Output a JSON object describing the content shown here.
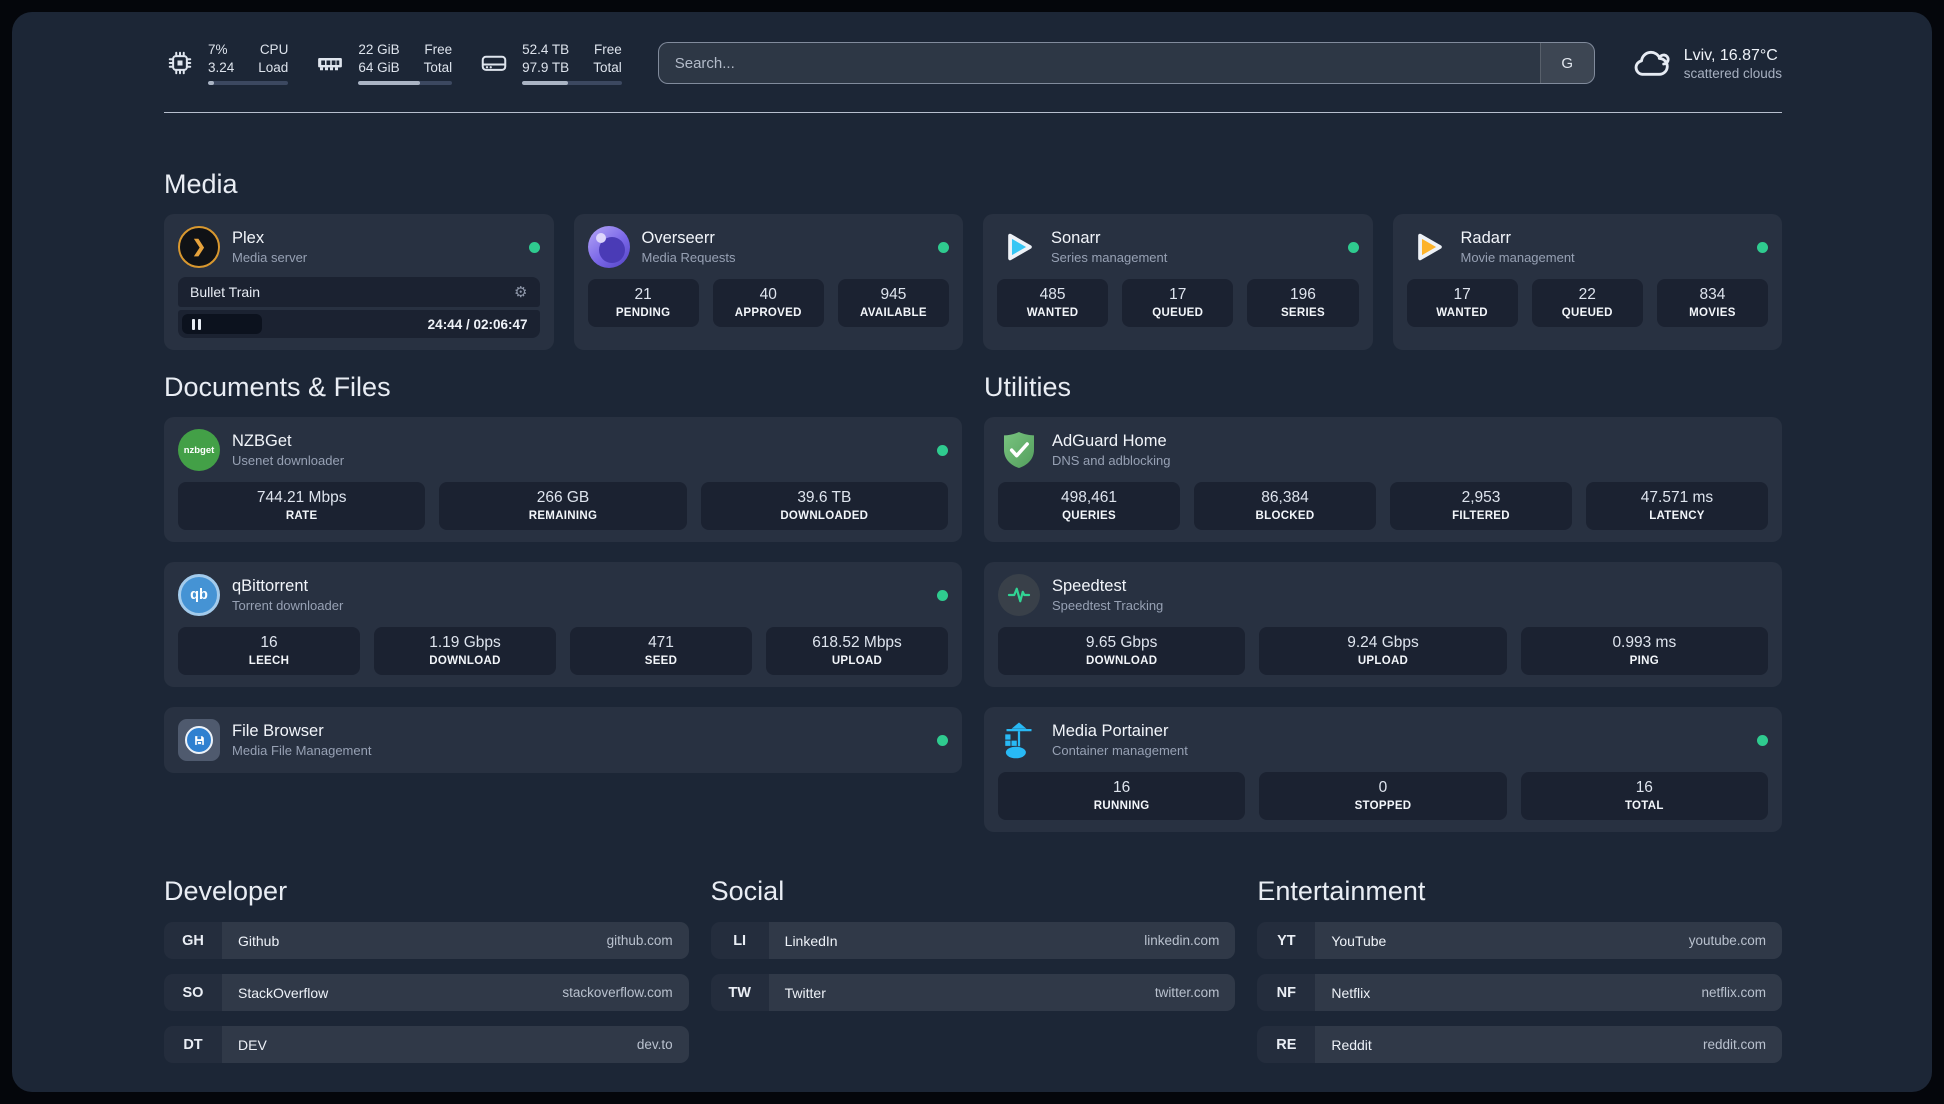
{
  "colors": {
    "background": "#1c2636",
    "card": "#263040",
    "status_online": "#2fcb8f",
    "plex_amber": "#e7a33c",
    "sonarr_cyan": "#36c6f4",
    "radarr_yellow": "#fdb32a",
    "portainer_blue": "#28b9f5"
  },
  "header": {
    "resources": [
      {
        "icon": "cpu-icon",
        "value_top": "7%",
        "value_bottom": "3.24",
        "label_top": "CPU",
        "label_bottom": "Load",
        "progress": 7
      },
      {
        "icon": "memory-icon",
        "value_top": "22 GiB",
        "value_bottom": "64 GiB",
        "label_top": "Free",
        "label_bottom": "Total",
        "progress": 66
      },
      {
        "icon": "disk-icon",
        "value_top": "52.4 TB",
        "value_bottom": "97.9 TB",
        "label_top": "Free",
        "label_bottom": "Total",
        "progress": 46
      }
    ],
    "search": {
      "placeholder": "Search...",
      "provider": "G"
    },
    "weather": {
      "icon": "cloud-icon",
      "location": "Lviv, 16.87°C",
      "condition": "scattered clouds"
    }
  },
  "sections": {
    "media": {
      "title": "Media",
      "plex": {
        "name": "Plex",
        "description": "Media server",
        "icon": "plex-icon",
        "status": "online",
        "now_playing": {
          "title": "Bullet Train",
          "time": "24:44 / 02:06:47",
          "progress_percent": 22,
          "state": "paused"
        }
      },
      "overseerr": {
        "name": "Overseerr",
        "description": "Media Requests",
        "icon": "overseerr-icon",
        "status": "online",
        "stats": [
          {
            "value": "21",
            "label": "PENDING"
          },
          {
            "value": "40",
            "label": "APPROVED"
          },
          {
            "value": "945",
            "label": "AVAILABLE"
          }
        ]
      },
      "sonarr": {
        "name": "Sonarr",
        "description": "Series management",
        "icon": "sonarr-icon",
        "status": "online",
        "stats": [
          {
            "value": "485",
            "label": "WANTED"
          },
          {
            "value": "17",
            "label": "QUEUED"
          },
          {
            "value": "196",
            "label": "SERIES"
          }
        ]
      },
      "radarr": {
        "name": "Radarr",
        "description": "Movie management",
        "icon": "radarr-icon",
        "status": "online",
        "stats": [
          {
            "value": "17",
            "label": "WANTED"
          },
          {
            "value": "22",
            "label": "QUEUED"
          },
          {
            "value": "834",
            "label": "MOVIES"
          }
        ]
      }
    },
    "documents": {
      "title": "Documents & Files",
      "nzbget": {
        "name": "NZBGet",
        "description": "Usenet downloader",
        "icon": "nzbget-icon",
        "status": "online",
        "stats": [
          {
            "value": "744.21 Mbps",
            "label": "RATE"
          },
          {
            "value": "266 GB",
            "label": "REMAINING"
          },
          {
            "value": "39.6 TB",
            "label": "DOWNLOADED"
          }
        ]
      },
      "qbittorrent": {
        "name": "qBittorrent",
        "description": "Torrent downloader",
        "icon": "qbittorrent-icon",
        "status": "online",
        "stats": [
          {
            "value": "16",
            "label": "LEECH"
          },
          {
            "value": "1.19 Gbps",
            "label": "DOWNLOAD"
          },
          {
            "value": "471",
            "label": "SEED"
          },
          {
            "value": "618.52 Mbps",
            "label": "UPLOAD"
          }
        ]
      },
      "filebrowser": {
        "name": "File Browser",
        "description": "Media File Management",
        "icon": "filebrowser-icon",
        "status": "online"
      }
    },
    "utilities": {
      "title": "Utilities",
      "adguard": {
        "name": "AdGuard Home",
        "description": "DNS and adblocking",
        "icon": "adguard-icon",
        "stats": [
          {
            "value": "498,461",
            "label": "QUERIES"
          },
          {
            "value": "86,384",
            "label": "BLOCKED"
          },
          {
            "value": "2,953",
            "label": "FILTERED"
          },
          {
            "value": "47.571 ms",
            "label": "LATENCY"
          }
        ]
      },
      "speedtest": {
        "name": "Speedtest",
        "description": "Speedtest Tracking",
        "icon": "speedtest-icon",
        "stats": [
          {
            "value": "9.65 Gbps",
            "label": "DOWNLOAD"
          },
          {
            "value": "9.24 Gbps",
            "label": "UPLOAD"
          },
          {
            "value": "0.993 ms",
            "label": "PING"
          }
        ]
      },
      "portainer": {
        "name": "Media Portainer",
        "description": "Container management",
        "icon": "portainer-icon",
        "status": "online",
        "stats": [
          {
            "value": "16",
            "label": "RUNNING"
          },
          {
            "value": "0",
            "label": "STOPPED"
          },
          {
            "value": "16",
            "label": "TOTAL"
          }
        ]
      }
    },
    "bookmarks": [
      {
        "title": "Developer",
        "links": [
          {
            "abbr": "GH",
            "name": "Github",
            "url": "github.com"
          },
          {
            "abbr": "SO",
            "name": "StackOverflow",
            "url": "stackoverflow.com"
          },
          {
            "abbr": "DT",
            "name": "DEV",
            "url": "dev.to"
          }
        ]
      },
      {
        "title": "Social",
        "links": [
          {
            "abbr": "LI",
            "name": "LinkedIn",
            "url": "linkedin.com"
          },
          {
            "abbr": "TW",
            "name": "Twitter",
            "url": "twitter.com"
          }
        ]
      },
      {
        "title": "Entertainment",
        "links": [
          {
            "abbr": "YT",
            "name": "YouTube",
            "url": "youtube.com"
          },
          {
            "abbr": "NF",
            "name": "Netflix",
            "url": "netflix.com"
          },
          {
            "abbr": "RE",
            "name": "Reddit",
            "url": "reddit.com"
          }
        ]
      }
    ]
  }
}
